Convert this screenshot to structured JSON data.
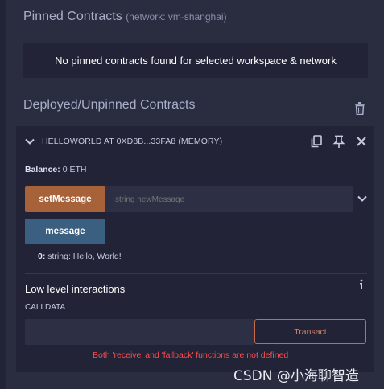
{
  "pinned": {
    "title": "Pinned Contracts",
    "network": "(network: vm-shanghai)",
    "empty_message": "No pinned contracts found for selected workspace & network"
  },
  "deployed": {
    "title": "Deployed/Unpinned Contracts"
  },
  "contract": {
    "name": "HELLOWORLD AT 0XD8B...33FA8 (MEMORY)",
    "balance_label": "Balance:",
    "balance_value": "0 ETH",
    "functions": {
      "set_label": "setMessage",
      "set_placeholder": "string newMessage",
      "message_label": "message"
    },
    "result": {
      "index": "0:",
      "value": "string: Hello, World!"
    }
  },
  "low_level": {
    "title": "Low level interactions",
    "calldata_label": "CALLDATA",
    "transact_label": "Transact",
    "error": "Both 'receive' and 'fallback' functions are not defined"
  },
  "watermark": "CSDN @小海聊智造",
  "colors": {
    "background": "#2a2c3f",
    "card": "#222336",
    "set_button": "#a8623a",
    "call_button": "#3b5f80",
    "transact_border": "#c76b4a",
    "error": "#ff4d4d"
  }
}
